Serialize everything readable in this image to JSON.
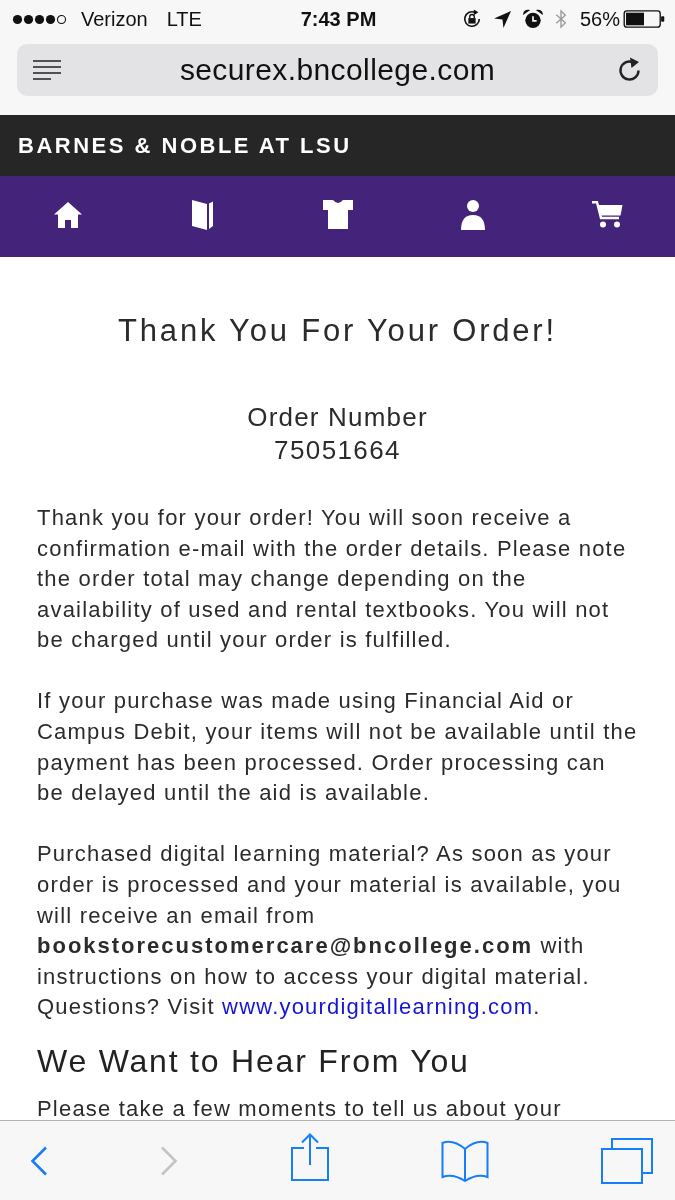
{
  "status_bar": {
    "carrier": "Verizon",
    "network": "LTE",
    "time": "7:43 PM",
    "bluetooth": {
      "connected": false
    },
    "battery": "56%"
  },
  "address_bar": {
    "url": "securex.bncollege.com"
  },
  "store_header": {
    "title": "BARNES & NOBLE AT LSU"
  },
  "content": {
    "title": "Thank You For Your Order!",
    "order_number_label": "Order Number",
    "order_number": "75051664",
    "paragraphs": [
      {
        "text": "Thank you for your order! You will soon receive a confirmation e-mail with the order details. Please note the order total may change depending on the availability of used and rental textbooks. You will not be charged until your order is fulfilled."
      },
      {
        "text": "If your purchase was made using Financial Aid or Campus Debit, your items will not be available until the payment has been processed. Order processing can be delayed until the aid is available."
      },
      {
        "text": "Purchased digital learning material? As soon as your order is processed and your material is available, you will receive an email from **bookstorecustomercare@bncollege.com** with instructions on how to access your digital material. Questions? Visit",
        "link": "www.yourdigitallearning.com",
        "after_link": "."
      }
    ],
    "heading": "We Want to Hear From You",
    "paragraph_after_heading": "Please take a few moments to tell us about your"
  },
  "toolbar": {
    "back": {
      "disabled": false
    },
    "forward": {
      "disabled": true
    }
  }
}
